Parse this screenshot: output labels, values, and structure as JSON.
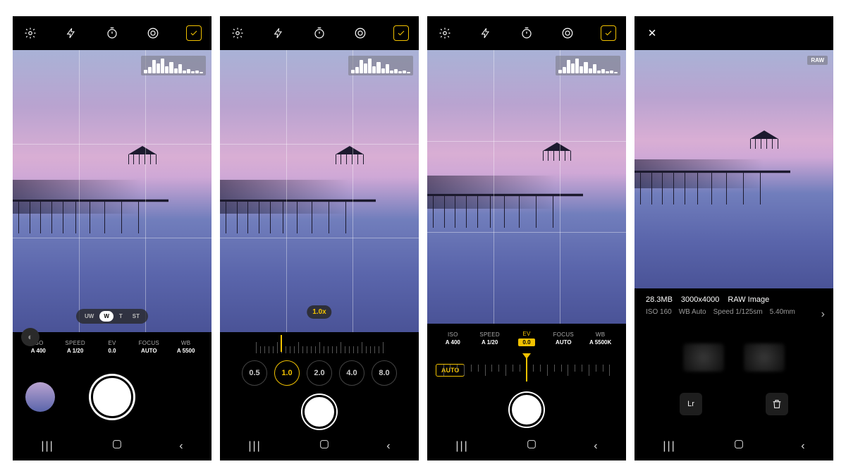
{
  "colors": {
    "accent": "#f2c200"
  },
  "icons": {
    "settings": "gear-icon",
    "flash": "flash-icon",
    "timer": "timer-icon",
    "ratio": "aspect-icon",
    "raw": "raw-icon",
    "close": "✕"
  },
  "screen1": {
    "lenses": [
      "UW",
      "W",
      "T",
      "ST"
    ],
    "lens_active": "W",
    "settings": [
      {
        "label": "ISO",
        "value": "A 400"
      },
      {
        "label": "SPEED",
        "value": "A 1/20"
      },
      {
        "label": "EV",
        "value": "0.0"
      },
      {
        "label": "FOCUS",
        "value": "AUTO"
      },
      {
        "label": "WB",
        "value": "A 5500"
      }
    ]
  },
  "screen2": {
    "zoom_value": "1.0x",
    "steps": [
      "0.5",
      "1.0",
      "2.0",
      "4.0",
      "8.0"
    ],
    "active_step": "1.0"
  },
  "screen3": {
    "settings": [
      {
        "label": "ISO",
        "value": "A 400"
      },
      {
        "label": "SPEED",
        "value": "A 1/20"
      },
      {
        "label": "EV",
        "value": "0.0",
        "active": true
      },
      {
        "label": "FOCUS",
        "value": "AUTO"
      },
      {
        "label": "WB",
        "value": "A 5500K"
      }
    ],
    "auto_label": "AUTO"
  },
  "screen4": {
    "raw_tag": "RAW",
    "size": "28.3MB",
    "dimensions": "3000x4000",
    "format": "RAW Image",
    "iso": "ISO 160",
    "wb": "WB Auto",
    "speed": "Speed 1/125sm",
    "focal": "5.40mm",
    "action_lr": "Lr",
    "action_delete": "trash-icon"
  },
  "nav": {
    "recents": "|||",
    "home": "○",
    "back": "‹"
  }
}
